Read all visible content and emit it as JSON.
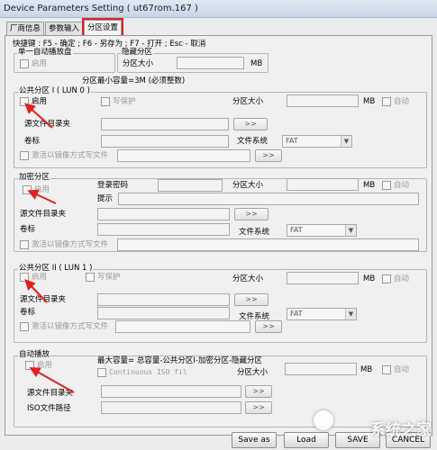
{
  "window": {
    "title": "Device Parameters Setting ( ut67rom.167 )"
  },
  "tabs": [
    {
      "label": "厂商信息"
    },
    {
      "label": "参数输入"
    },
    {
      "label": "分区设置"
    }
  ],
  "hotkeys": "快捷键 : F5 - 确定 ; F6 - 另存为 ; F7 - 打开 ; Esc - 取消",
  "single_autorun": {
    "title": "单一自动播放盘",
    "enable": "启用"
  },
  "hidden_partition": {
    "title": "隐藏分区",
    "size_label": "分区大小",
    "unit": "MB"
  },
  "min_capacity_note": "分区最小容量=3M (必须整数)",
  "public1": {
    "title": "公共分区 I ( LUN 0 )",
    "enable": "启用",
    "write_protect": "写保护",
    "size_label": "分区大小",
    "unit": "MB",
    "auto": "自动",
    "source_dir": "源文件目录夹",
    "browse": ">>",
    "volume": "卷标",
    "fs_label": "文件系统",
    "fs_value": "FAT",
    "image_write": "激活以镜像方式写文件",
    "browse2": ">>"
  },
  "encrypted": {
    "title": "加密分区",
    "enable": "启用",
    "login_pwd": "登录密码",
    "size_label": "分区大小",
    "unit": "MB",
    "auto": "自动",
    "hint": "提示",
    "source_dir": "源文件目录夹",
    "browse": ">>",
    "volume": "卷标",
    "fs_label": "文件系统",
    "fs_value": "FAT",
    "image_write": "激活以镜像方式写文件",
    "browse2": ">>"
  },
  "public2": {
    "title": "公共分区 II ( LUN 1 )",
    "enable": "启用",
    "write_protect": "写保护",
    "size_label": "分区大小",
    "unit": "MB",
    "auto": "自动",
    "source_dir": "源文件目录夹",
    "browse": ">>",
    "volume": "卷标",
    "fs_label": "文件系统",
    "fs_value": "FAT",
    "image_write": "激活以镜像方式写文件",
    "browse2": ">>"
  },
  "autorun": {
    "title": "自动播放",
    "enable": "启用",
    "max_capacity_note": "最大容量= 总容量-公共分区I-加密分区-隐藏分区",
    "continuous_iso": "Continuous ISO fil",
    "size_label": "分区大小",
    "unit": "MB",
    "auto": "自动",
    "source_dir": "源文件目录夹",
    "browse": ">>",
    "iso_path": "ISO文件路径",
    "browse2": ">>"
  },
  "footer": {
    "save_as": "Save as",
    "open": "Load",
    "save": "SAVE",
    "cancel": "CANCEL"
  },
  "watermark": "系统之家",
  "colors": {
    "highlight_red": "#e02020",
    "title_bar": "#c8d6e8"
  }
}
